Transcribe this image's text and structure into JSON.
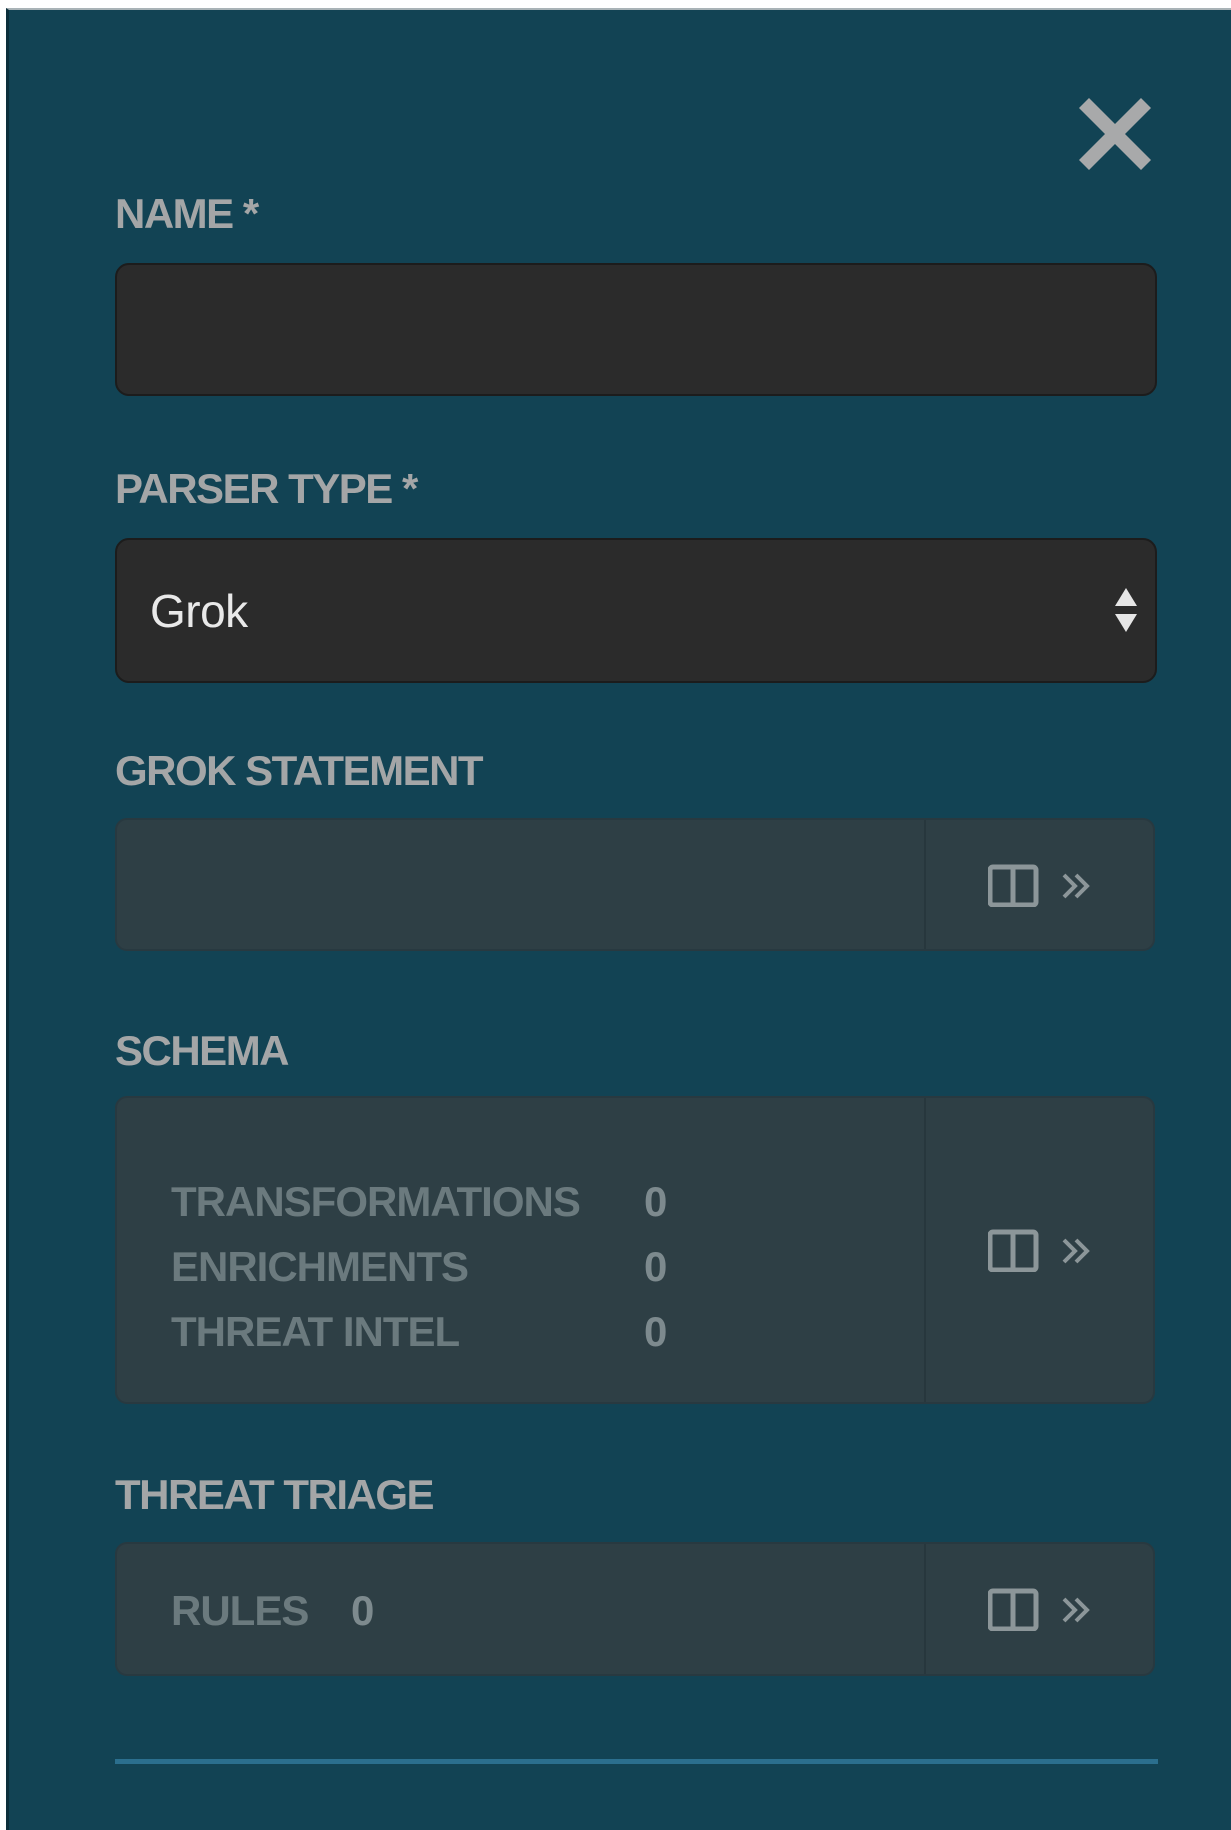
{
  "panel": {
    "close_icon": "close-icon"
  },
  "name_field": {
    "label": "NAME *",
    "value": "",
    "placeholder": ""
  },
  "parser_type": {
    "label": "PARSER TYPE *",
    "selected": "Grok"
  },
  "grok_statement": {
    "label": "GROK STATEMENT",
    "icon": "split-panel-icon",
    "expand_icon": "double-chevron-right-icon"
  },
  "schema": {
    "label": "SCHEMA",
    "rows": [
      {
        "label": "TRANSFORMATIONS",
        "value": "0"
      },
      {
        "label": "ENRICHMENTS",
        "value": "0"
      },
      {
        "label": "THREAT INTEL",
        "value": "0"
      }
    ]
  },
  "threat_triage": {
    "label": "THREAT TRIAGE",
    "rules_label": "RULES",
    "rules_value": "0"
  },
  "colors": {
    "panel_bg": "#124354",
    "input_bg": "#2b2b2b",
    "card_bg": "#2e3f45",
    "label": "#a4a6a7",
    "accent_rule": "#2b6f8e"
  }
}
